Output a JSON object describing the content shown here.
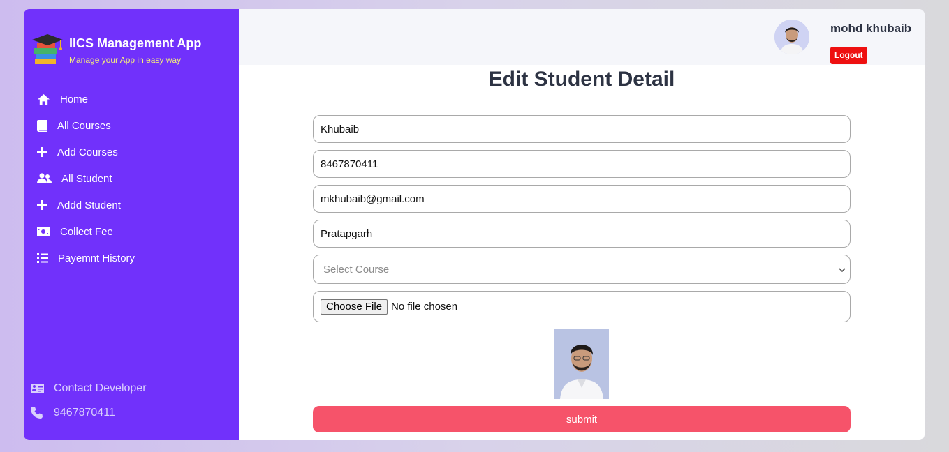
{
  "brand": {
    "title": "IICS Management App",
    "subtitle": "Manage your App in easy way"
  },
  "nav": [
    {
      "label": "Home",
      "icon": "home-icon"
    },
    {
      "label": "All Courses",
      "icon": "book-icon"
    },
    {
      "label": "Add Courses",
      "icon": "plus-icon"
    },
    {
      "label": "All Student",
      "icon": "users-icon"
    },
    {
      "label": "Addd Student",
      "icon": "plus-icon"
    },
    {
      "label": "Collect Fee",
      "icon": "money-bill-icon"
    },
    {
      "label": "Payemnt History",
      "icon": "list-icon"
    }
  ],
  "contact": {
    "label": "Contact Developer",
    "phone": "9467870411"
  },
  "header": {
    "user_name": "mohd khubaib",
    "logout_label": "Logout"
  },
  "form": {
    "title": "Edit Student Detail",
    "name": "Khubaib",
    "phone": "8467870411",
    "email": "mkhubaib@gmail.com",
    "address": "Pratapgarh",
    "course_placeholder": "Select Course",
    "file_button": "Choose File",
    "file_status": "No file chosen",
    "submit_label": "submit"
  },
  "colors": {
    "sidebar": "#7131fb",
    "submit": "#f6536a",
    "logout": "#ee1010",
    "subtitle": "#f6f07a"
  }
}
